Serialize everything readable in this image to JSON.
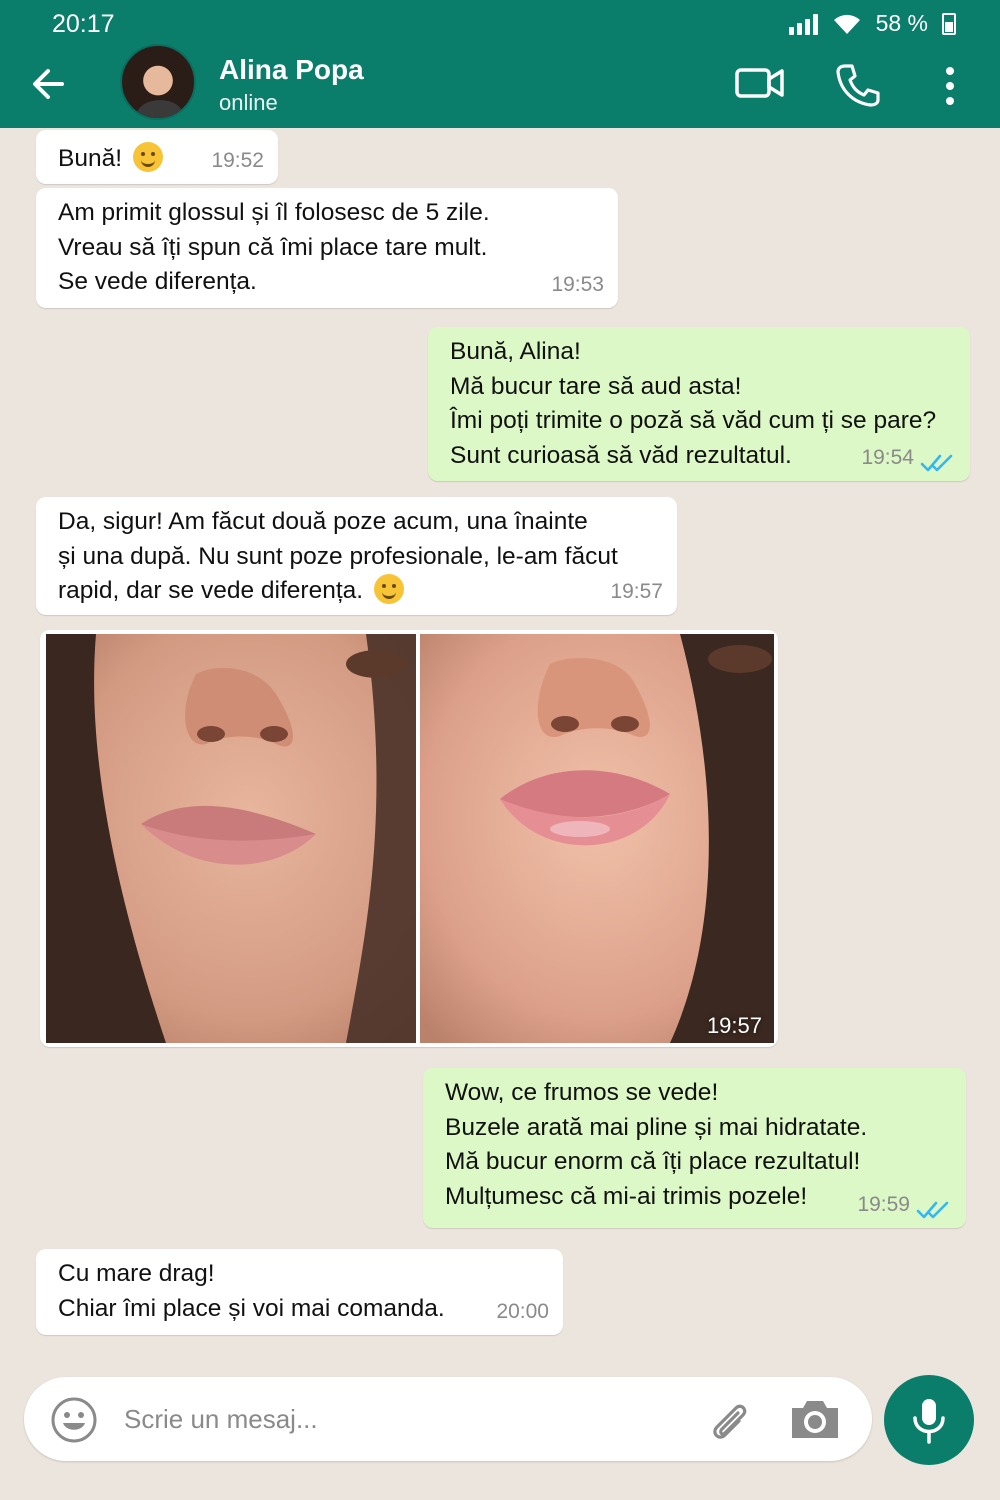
{
  "status_bar": {
    "time": "20:17",
    "battery": "58 %"
  },
  "header": {
    "contact_name": "Alina Popa",
    "contact_status": "online"
  },
  "messages": [
    {
      "lines": [
        "Bună!"
      ],
      "time": "19:52"
    },
    {
      "lines": [
        "Am primit glossul și îl folosesc de 5 zile.",
        "Vreau să îți spun că îmi place tare mult.",
        "Se vede diferența."
      ],
      "time": "19:53"
    },
    {
      "lines": [
        "Bună, Alina!",
        "Mă bucur tare să aud asta!",
        "Îmi poți trimite o poză să văd cum ți se pare?",
        "Sunt curioasă să văd rezultatul."
      ],
      "time": "19:54"
    },
    {
      "lines": [
        "Da, sigur! Am făcut două poze acum, una înainte",
        "și una după. Nu sunt poze profesionale, le-am făcut",
        "rapid, dar se vede diferența."
      ],
      "time": "19:57"
    },
    {
      "time": "19:57"
    },
    {
      "lines": [
        "Wow, ce frumos se vede!",
        "Buzele arată mai pline și mai hidratate.",
        "Mă bucur enorm că îți place rezultatul!",
        "Mulțumesc că mi-ai trimis pozele!"
      ],
      "time": "19:59"
    },
    {
      "lines": [
        "Cu mare drag!",
        "Chiar îmi place și voi mai comanda."
      ],
      "time": "20:00"
    }
  ],
  "composer": {
    "placeholder": "Scrie un mesaj..."
  },
  "icons": {
    "back": "arrow-left-icon",
    "video": "video-camera-icon",
    "call": "phone-icon",
    "menu": "more-vertical-icon",
    "emoji": "emoji-icon",
    "attach": "paperclip-icon",
    "camera": "camera-icon",
    "mic": "microphone-icon",
    "read": "double-check-icon"
  },
  "colors": {
    "header": "#0b7d6b",
    "outgoing_bubble": "#dcf8c6",
    "incoming_bubble": "#ffffff",
    "chat_bg": "#ece5dd",
    "read_ticks": "#34b7f1"
  }
}
